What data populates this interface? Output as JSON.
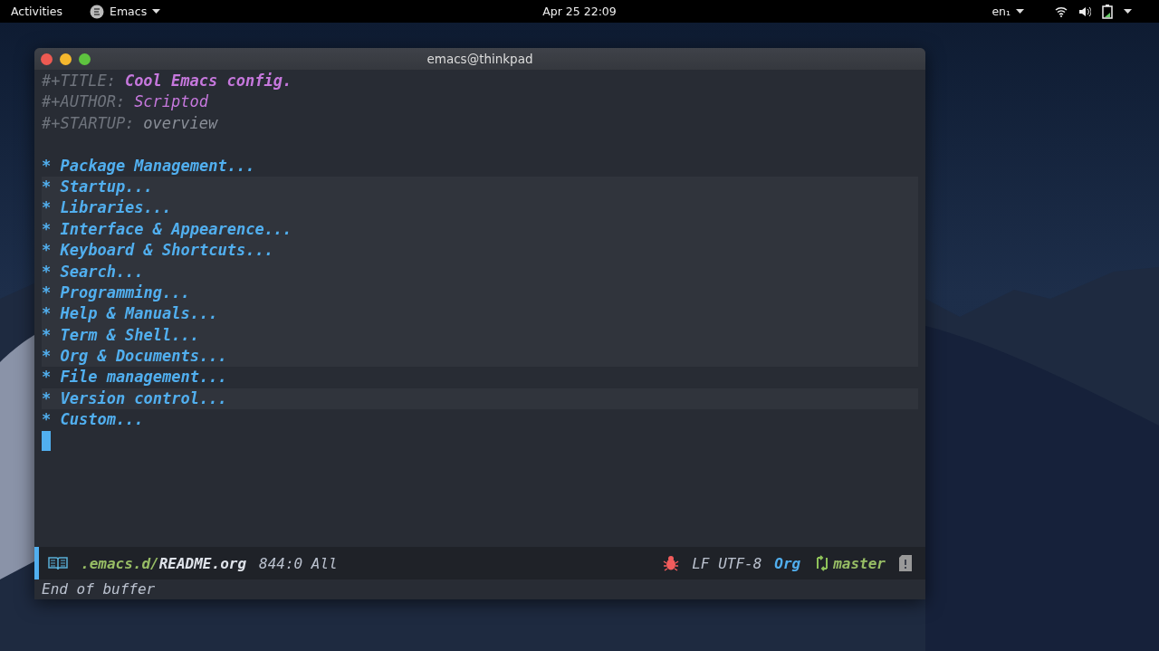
{
  "top_bar": {
    "activities": "Activities",
    "app_menu": "Emacs",
    "clock": "Apr 25  22:09",
    "keyboard_layout": "en₁"
  },
  "window": {
    "title": "emacs@thinkpad"
  },
  "header_lines": [
    {
      "keyword": "#+TITLE:",
      "value": "Cool Emacs config.",
      "kind": "title"
    },
    {
      "keyword": "#+AUTHOR:",
      "value": "Scriptod",
      "kind": "author"
    },
    {
      "keyword": "#+STARTUP:",
      "value": "overview",
      "kind": "option"
    }
  ],
  "headings": [
    {
      "bullet": "*",
      "text": "Package Management...",
      "highlighted": false
    },
    {
      "bullet": "*",
      "text": "Startup...",
      "highlighted": true
    },
    {
      "bullet": "*",
      "text": "Libraries...",
      "highlighted": true
    },
    {
      "bullet": "*",
      "text": "Interface & Appearence...",
      "highlighted": true
    },
    {
      "bullet": "*",
      "text": "Keyboard & Shortcuts...",
      "highlighted": true
    },
    {
      "bullet": "*",
      "text": "Search...",
      "highlighted": true
    },
    {
      "bullet": "*",
      "text": "Programming...",
      "highlighted": true
    },
    {
      "bullet": "*",
      "text": "Help & Manuals...",
      "highlighted": true
    },
    {
      "bullet": "*",
      "text": "Term & Shell...",
      "highlighted": true
    },
    {
      "bullet": "*",
      "text": "Org & Documents...",
      "highlighted": true
    },
    {
      "bullet": "*",
      "text": "File management...",
      "highlighted": false
    },
    {
      "bullet": "*",
      "text": "Version control...",
      "highlighted": true
    },
    {
      "bullet": "*",
      "text": "Custom...",
      "highlighted": false
    }
  ],
  "mode_line": {
    "directory": ".emacs.d/",
    "file": "README.org",
    "position": "844:0 All",
    "encoding": "LF UTF-8",
    "major_mode": "Org",
    "branch": "master"
  },
  "echo_area": "End of buffer"
}
